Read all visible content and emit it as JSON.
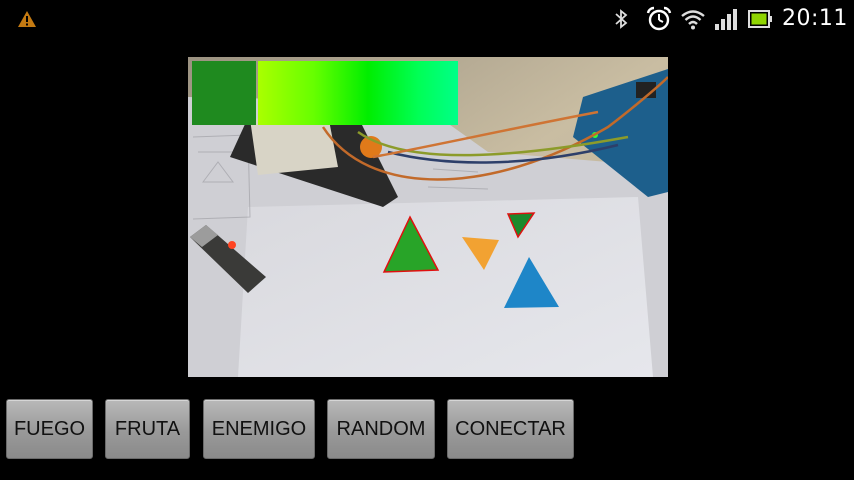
{
  "status_bar": {
    "time": "20:11",
    "icons": [
      "warning-icon",
      "bluetooth-icon",
      "alarm-icon",
      "wifi-icon",
      "signal-icon",
      "battery-icon"
    ]
  },
  "colors": {
    "swatch": "#1f8a1f",
    "gradient_start": "#aaff00",
    "gradient_end": "#00ff88",
    "detected_outline": "#e01010"
  },
  "buttons": {
    "fuego": "FUEGO",
    "fruta": "FRUTA",
    "enemigo": "ENEMIGO",
    "random": "RANDOM",
    "conectar": "CONECTAR"
  }
}
